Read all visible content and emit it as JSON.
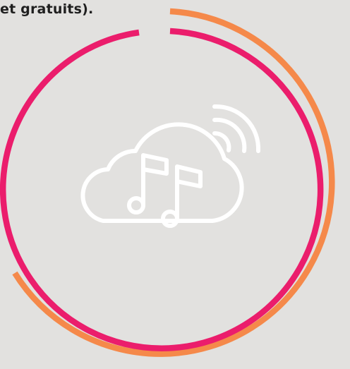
{
  "text": {
    "caption": "et gratuits)."
  },
  "icons": {
    "main": "cloud-music-streaming-icon"
  },
  "colors": {
    "background": "#e2e1df",
    "inner_ring": "#eb1d6c",
    "outer_ring": "#f5894a",
    "icon": "#ffffff",
    "text": "#1f1f1f"
  }
}
